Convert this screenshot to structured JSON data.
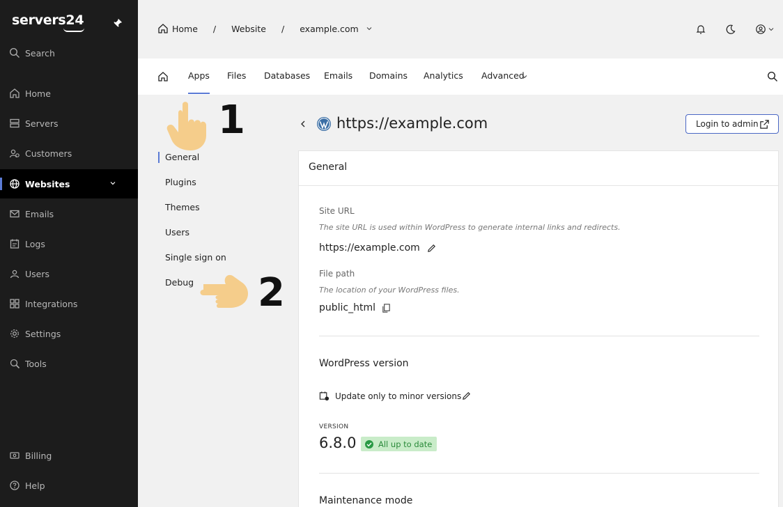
{
  "brand": {
    "name": "servers24"
  },
  "sidebar": {
    "search_label": "Search",
    "items": [
      {
        "label": "Home",
        "icon": "home-icon"
      },
      {
        "label": "Servers",
        "icon": "server-icon"
      },
      {
        "label": "Customers",
        "icon": "customers-icon"
      },
      {
        "label": "Websites",
        "icon": "globe-icon",
        "active": true
      },
      {
        "label": "Emails",
        "icon": "mail-icon"
      },
      {
        "label": "Logs",
        "icon": "logs-icon"
      },
      {
        "label": "Users",
        "icon": "users-icon"
      },
      {
        "label": "Integrations",
        "icon": "integrations-icon"
      },
      {
        "label": "Settings",
        "icon": "gear-icon"
      },
      {
        "label": "Tools",
        "icon": "tools-icon"
      }
    ],
    "billing_label": "Billing",
    "help_label": "Help"
  },
  "breadcrumb": {
    "home": "Home",
    "section": "Website",
    "site": "example.com",
    "sep": "/"
  },
  "tabs": {
    "apps": "Apps",
    "files": "Files",
    "databases": "Databases",
    "emails": "Emails",
    "domains": "Domains",
    "analytics": "Analytics",
    "advanced": "Advanced",
    "active": "Apps"
  },
  "subnav": {
    "items": [
      "General",
      "Plugins",
      "Themes",
      "Users",
      "Single sign on",
      "Debug"
    ],
    "active": "General"
  },
  "page": {
    "title": "https://example.com",
    "login_button": "Login to admin"
  },
  "card": {
    "title": "General",
    "site_url_label": "Site URL",
    "site_url_desc": "The site URL is used within WordPress to generate internal links and redirects.",
    "site_url_value": "https://example.com",
    "file_path_label": "File path",
    "file_path_desc": "The location of your WordPress files.",
    "file_path_value": "public_html",
    "wp_version_title": "WordPress version",
    "update_policy": "Update only to minor versions",
    "version_label": "VERSION",
    "version_value": "6.8.0",
    "version_status": "All up to date",
    "maintenance_title": "Maintenance mode"
  },
  "annotations": {
    "step1": "1",
    "step2": "2"
  },
  "colors": {
    "accent": "#5b7bd5",
    "sidebar_bg": "#1c1c1c",
    "badge_bg": "#c9ecc9",
    "badge_text": "#2a8a3a",
    "hand": "#f5c97f"
  }
}
